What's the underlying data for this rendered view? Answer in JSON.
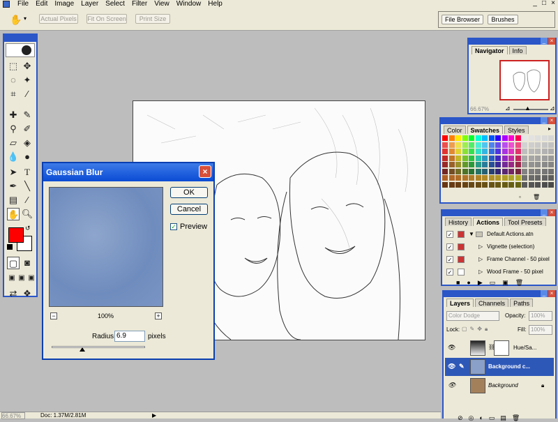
{
  "menu": [
    "File",
    "Edit",
    "Image",
    "Layer",
    "Select",
    "Filter",
    "View",
    "Window",
    "Help"
  ],
  "window_controls": [
    "_",
    "□",
    "×"
  ],
  "options_bar": {
    "actual_pixels": "Actual Pixels",
    "fit_on_screen": "Fit On Screen",
    "print_size": "Print Size",
    "file_browser": "File Browser",
    "brushes": "Brushes"
  },
  "colors": {
    "foreground": "#ff0000",
    "background": "#ffffff",
    "titlebar": "#0a4bd4",
    "workspace": "#bdbdbd"
  },
  "dialog": {
    "title": "Gaussian Blur",
    "ok": "OK",
    "cancel": "Cancel",
    "preview_label": "Preview",
    "preview_checked": true,
    "zoom": "100%",
    "radius_label": "Radius:",
    "radius_value": "6.9",
    "radius_unit": "pixels"
  },
  "navigator": {
    "tabs": [
      "Navigator",
      "Info"
    ],
    "zoom": "66.67%"
  },
  "swatches": {
    "tabs": [
      "Color",
      "Swatches",
      "Styles"
    ]
  },
  "actions": {
    "tabs": [
      "History",
      "Actions",
      "Tool Presets"
    ],
    "items": [
      {
        "label": "Default Actions.atn"
      },
      {
        "label": "Vignette (selection)"
      },
      {
        "label": "Frame Channel - 50 pixel"
      },
      {
        "label": "Wood Frame - 50 pixel"
      }
    ]
  },
  "layers": {
    "tabs": [
      "Layers",
      "Channels",
      "Paths"
    ],
    "blend_mode": "Color Dodge",
    "opacity_label": "Opacity:",
    "opacity": "100%",
    "lock_label": "Lock:",
    "fill_label": "Fill:",
    "fill": "100%",
    "items": [
      {
        "name": "Hue/Sa..."
      },
      {
        "name": "Background c..."
      },
      {
        "name": "Background"
      }
    ]
  },
  "status": {
    "zoom": "66.67%",
    "doc": "Doc: 1.37M/2.81M"
  }
}
